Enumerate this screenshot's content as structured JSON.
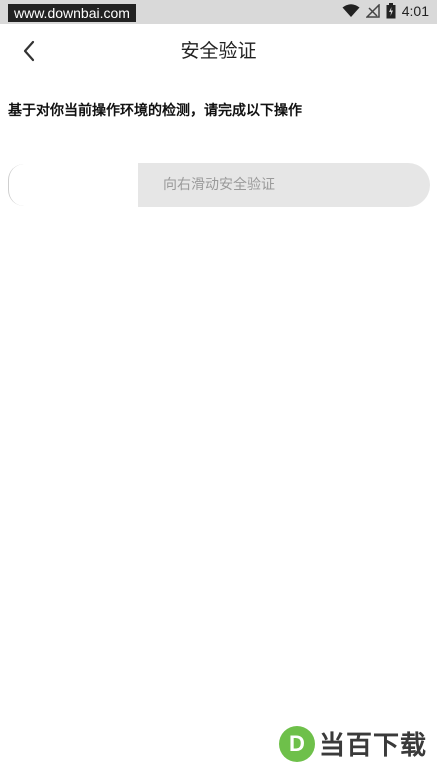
{
  "status_bar": {
    "watermark": "www.downbai.com",
    "time": "4:01"
  },
  "nav": {
    "title": "安全验证"
  },
  "instruction": "基于对你当前操作环境的检测，请完成以下操作",
  "slider": {
    "label": "向右滑动安全验证"
  },
  "watermark_logo": {
    "letter": "D",
    "text": "当百下载"
  },
  "colors": {
    "status_bar": "#d9d9d9",
    "slider_track": "#e6e6e6",
    "slider_text": "#9a9a9a",
    "logo_green": "#6ec04a"
  },
  "icons": [
    "wifi-icon",
    "no-signal-icon",
    "battery-icon",
    "back-arrow-icon"
  ]
}
